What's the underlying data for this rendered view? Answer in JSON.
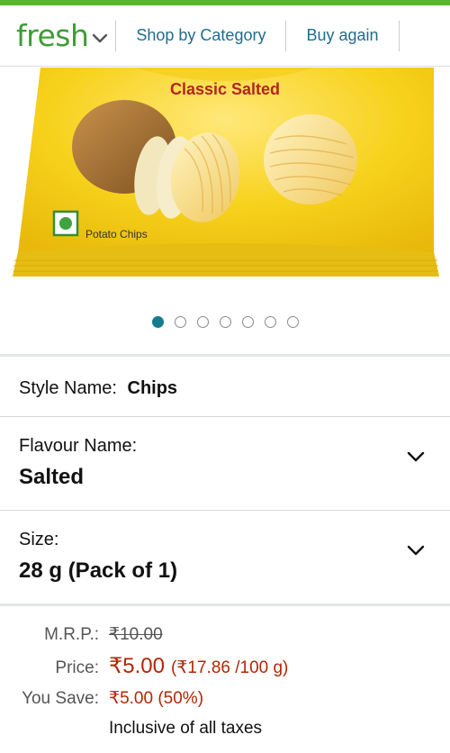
{
  "nav": {
    "brand": "fresh",
    "links": [
      "Shop by Category",
      "Buy again"
    ]
  },
  "product_image": {
    "pack_title": "Classic Salted",
    "pack_subtitle": "Potato Chips"
  },
  "carousel": {
    "count": 7,
    "active": 0
  },
  "style": {
    "label": "Style Name:",
    "value": "Chips"
  },
  "flavour": {
    "label": "Flavour Name:",
    "value": "Salted"
  },
  "size": {
    "label": "Size:",
    "value": "28 g (Pack of 1)"
  },
  "pricing": {
    "mrp_label": "M.R.P.:",
    "mrp_value": "₹10.00",
    "price_label": "Price:",
    "price_value": "₹5.00",
    "price_unit": "(₹17.86 /100 g)",
    "save_label": "You Save:",
    "save_value": "₹5.00 (50%)",
    "tax_note": "Inclusive of all taxes"
  },
  "colors": {
    "brand_green": "#3f9c35",
    "link_blue": "#1f6c8c",
    "price_red": "#b12704",
    "dot_active": "#147c8e"
  }
}
